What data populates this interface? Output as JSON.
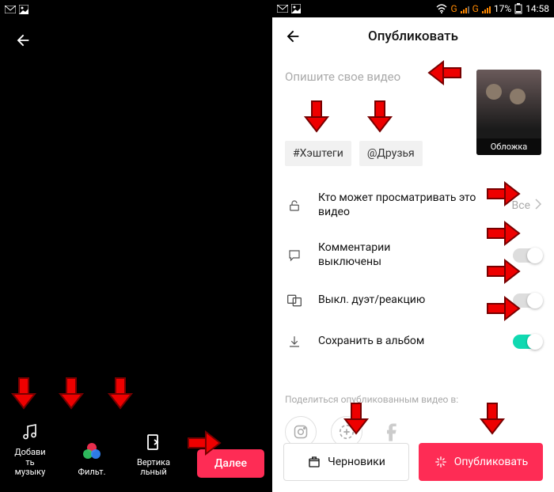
{
  "left": {
    "actions": {
      "add_music": "Добави\nть\nмузыку",
      "filters": "Фильт.",
      "vertical": "Вертика\nльный"
    },
    "next_label": "Далее"
  },
  "right": {
    "status": {
      "battery": "17%",
      "time": "14:58",
      "net": "G"
    },
    "title": "Опубликовать",
    "desc_placeholder": "Опишите свое видео",
    "hashtags_label": "#Хэштеги",
    "friends_label": "@Друзья",
    "cover_label": "Обложка",
    "options": {
      "privacy_label": "Кто может просматривать это\nвидео",
      "privacy_value": "Все",
      "comments_label": "Комментарии\nвыключены",
      "duet_label": "Выкл. дуэт/реакцию",
      "save_label": "Сохранить в альбом"
    },
    "share_label": "Поделиться опубликованным видео в:",
    "drafts_label": "Черновики",
    "publish_label": "Опубликовать"
  }
}
